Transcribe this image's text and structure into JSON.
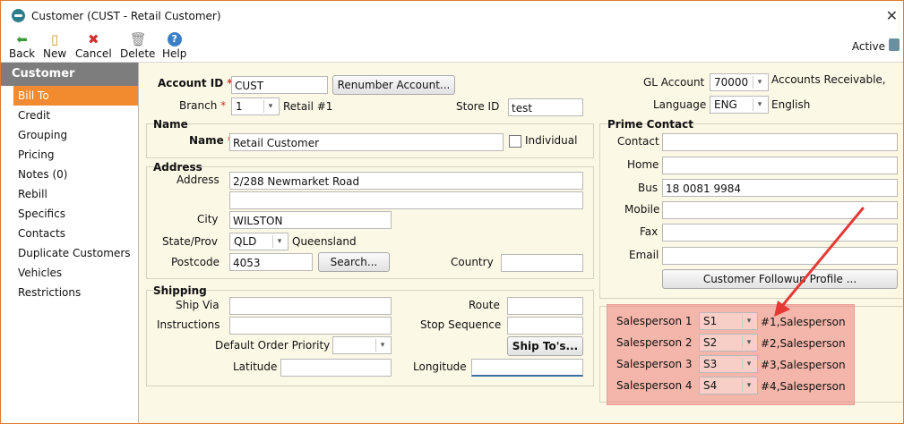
{
  "window": {
    "title": "Customer  (CUST  -  Retail Customer)",
    "close": "✕"
  },
  "toolbar": {
    "back": "Back",
    "new": "New",
    "cancel": "Cancel",
    "delete": "Delete",
    "help": "Help",
    "status": "Active"
  },
  "nav": {
    "header": "Customer",
    "items": [
      "Bill To",
      "Credit",
      "Grouping",
      "Pricing",
      "Notes (0)",
      "Rebill",
      "Specifics",
      "Contacts",
      "Duplicate Customers",
      "Vehicles",
      "Restrictions"
    ]
  },
  "account": {
    "label": "Account ID",
    "value": "CUST",
    "renumber": "Renumber Account..."
  },
  "branch": {
    "label": "Branch",
    "value": "1",
    "desc": "Retail #1"
  },
  "store": {
    "label": "Store ID",
    "value": "test"
  },
  "gl": {
    "label": "GL Account",
    "value": "70000",
    "desc": "Accounts Receivable,"
  },
  "language": {
    "label": "Language",
    "value": "ENG",
    "desc": "English"
  },
  "name_group": {
    "title": "Name",
    "label": "Name",
    "value": "Retail Customer",
    "individual": "Individual"
  },
  "address_group": {
    "title": "Address",
    "address_label": "Address",
    "address1": "2/288 Newmarket Road",
    "address2": "",
    "city_label": "City",
    "city": "WILSTON",
    "state_label": "State/Prov",
    "state": "QLD",
    "state_desc": "Queensland",
    "postcode_label": "Postcode",
    "postcode": "4053",
    "search": "Search...",
    "country_label": "Country",
    "country": ""
  },
  "shipping_group": {
    "title": "Shipping",
    "ship_via": "Ship Via",
    "instructions": "Instructions",
    "priority": "Default Order Priority",
    "latitude": "Latitude",
    "longitude": "Longitude",
    "route": "Route",
    "stop_sequence": "Stop Sequence",
    "ship_tos": "Ship To's..."
  },
  "prime_contact": {
    "title": "Prime Contact",
    "contact": "Contact",
    "home": "Home",
    "bus": "Bus",
    "bus_value": "18 0081 9984",
    "mobile": "Mobile",
    "fax": "Fax",
    "email": "Email",
    "followup": "Customer Followup Profile ..."
  },
  "salespersons": [
    {
      "label": "Salesperson 1",
      "code": "S1",
      "desc": "#1,Salesperson"
    },
    {
      "label": "Salesperson 2",
      "code": "S2",
      "desc": "#2,Salesperson"
    },
    {
      "label": "Salesperson 3",
      "code": "S3",
      "desc": "#3,Salesperson"
    },
    {
      "label": "Salesperson 4",
      "code": "S4",
      "desc": "#4,Salesperson"
    }
  ],
  "colors": {
    "accent": "#f28a2f",
    "highlight": "#ee8078",
    "arrow": "#e53935"
  }
}
